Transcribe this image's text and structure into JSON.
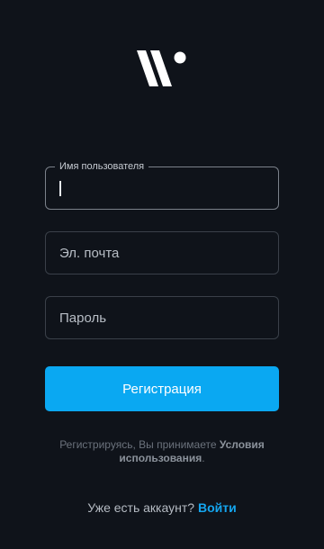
{
  "brand": {
    "logo_icon": "brand-logo-icon",
    "accent_color": "#0aa8f2",
    "background_color": "#0f131a"
  },
  "form": {
    "username": {
      "label": "Имя пользователя",
      "value": ""
    },
    "email": {
      "placeholder": "Эл. почта",
      "value": ""
    },
    "password": {
      "placeholder": "Пароль",
      "value": ""
    },
    "register_button": "Регистрация"
  },
  "terms": {
    "prefix": "Регистрируясь, Вы принимаете ",
    "link": "Условия использования",
    "suffix": "."
  },
  "login": {
    "question": "Уже есть аккаунт?",
    "link": "Войти"
  }
}
